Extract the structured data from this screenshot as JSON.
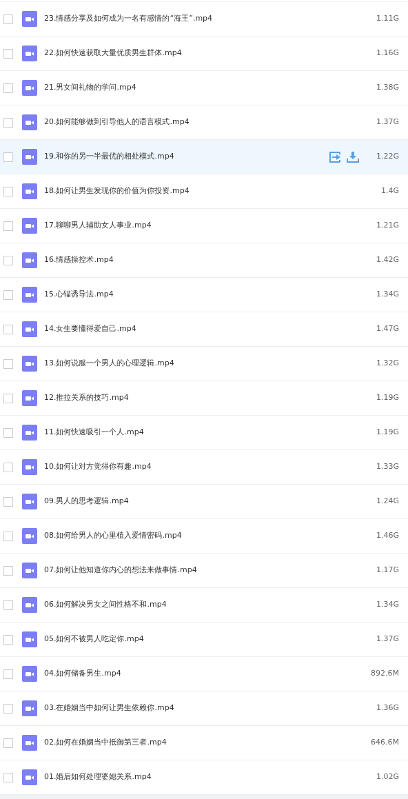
{
  "files": [
    {
      "name": "23.情感分享及如何成为一名有感情的“海王”.mp4",
      "size": "1.11G",
      "checked": false,
      "hovered": false
    },
    {
      "name": "22.如何快速获取大量优质男生群体.mp4",
      "size": "1.16G",
      "checked": false,
      "hovered": false
    },
    {
      "name": "21.男女间礼物的学问.mp4",
      "size": "1.38G",
      "checked": false,
      "hovered": false
    },
    {
      "name": "20.如何能够做到引导他人的语言模式.mp4",
      "size": "1.37G",
      "checked": false,
      "hovered": false
    },
    {
      "name": "19.和你的另一半最优的相处模式.mp4",
      "size": "1.22G",
      "checked": false,
      "hovered": true
    },
    {
      "name": "18.如何让男生发现你的价值为你投资.mp4",
      "size": "1.4G",
      "checked": false,
      "hovered": false
    },
    {
      "name": "17.聊聊男人辅助女人事业.mp4",
      "size": "1.21G",
      "checked": false,
      "hovered": false
    },
    {
      "name": "16.情感操控术.mp4",
      "size": "1.42G",
      "checked": false,
      "hovered": false
    },
    {
      "name": "15.心锚诱导法.mp4",
      "size": "1.34G",
      "checked": false,
      "hovered": false
    },
    {
      "name": "14.女生要懂得爱自己.mp4",
      "size": "1.47G",
      "checked": false,
      "hovered": false
    },
    {
      "name": "13.如何说服一个男人的心理逻辑.mp4",
      "size": "1.32G",
      "checked": false,
      "hovered": false
    },
    {
      "name": "12.推拉关系的技巧.mp4",
      "size": "1.19G",
      "checked": false,
      "hovered": false
    },
    {
      "name": "11.如何快速吸引一个人.mp4",
      "size": "1.19G",
      "checked": false,
      "hovered": false
    },
    {
      "name": "10.如何让对方觉得你有趣.mp4",
      "size": "1.33G",
      "checked": false,
      "hovered": false
    },
    {
      "name": "09.男人的思考逻辑.mp4",
      "size": "1.24G",
      "checked": false,
      "hovered": false
    },
    {
      "name": "08.如何给男人的心里植入爱情密码.mp4",
      "size": "1.46G",
      "checked": false,
      "hovered": false
    },
    {
      "name": "07.如何让他知道你内心的想法来做事情.mp4",
      "size": "1.17G",
      "checked": false,
      "hovered": false
    },
    {
      "name": "06.如何解决男女之间性格不和.mp4",
      "size": "1.34G",
      "checked": false,
      "hovered": false
    },
    {
      "name": "05.如何不被男人吃定你.mp4",
      "size": "1.37G",
      "checked": false,
      "hovered": false
    },
    {
      "name": "04.如何储备男生.mp4",
      "size": "892.6M",
      "checked": false,
      "hovered": false
    },
    {
      "name": "03.在婚姻当中如何让男生依赖你.mp4",
      "size": "1.36G",
      "checked": false,
      "hovered": false
    },
    {
      "name": "02.如何在婚姻当中抵御第三者.mp4",
      "size": "646.6M",
      "checked": false,
      "hovered": false
    },
    {
      "name": "01.婚后如何处理婆媳关系.mp4",
      "size": "1.02G",
      "checked": false,
      "hovered": false
    }
  ]
}
